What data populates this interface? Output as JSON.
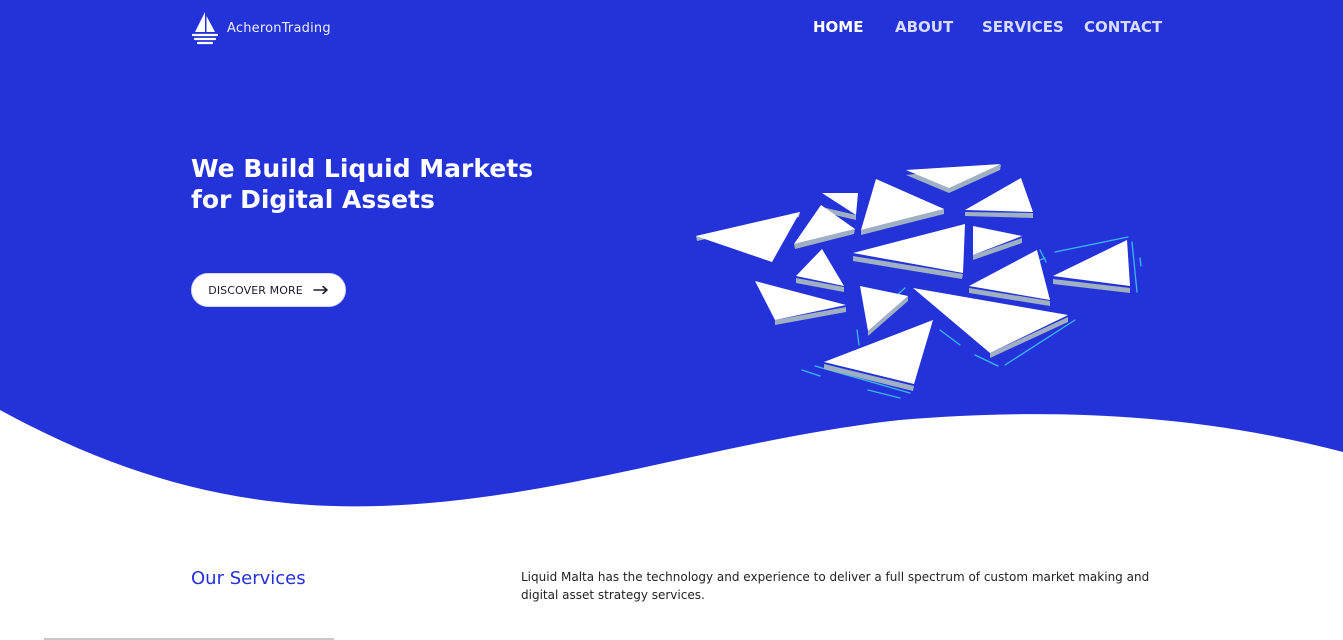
{
  "brand": {
    "name": "AcheronTrading",
    "logo_icon": "sailboat-icon",
    "primary_color": "#2433d9"
  },
  "nav": {
    "items": [
      {
        "label": "HOME",
        "active": true
      },
      {
        "label": "ABOUT",
        "active": false
      },
      {
        "label": "SERVICES",
        "active": false
      },
      {
        "label": "CONTACT",
        "active": false
      }
    ]
  },
  "hero": {
    "title_line1": "We Build Liquid Markets",
    "title_line2": "for Digital Assets",
    "cta_label": "DISCOVER MORE",
    "cta_icon": "arrow-right-icon",
    "illustration_icon": "shattered-triangles-illustration"
  },
  "services": {
    "title": "Our Services",
    "description": "Liquid Malta has the technology and experience to deliver a full spectrum of custom market making and digital asset strategy services."
  }
}
